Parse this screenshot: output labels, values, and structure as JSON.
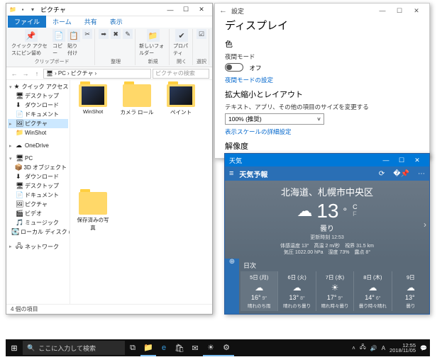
{
  "explorer": {
    "title": "ピクチャ",
    "tabs": {
      "file": "ファイル",
      "home": "ホーム",
      "share": "共有",
      "view": "表示"
    },
    "ribbon": {
      "g1": {
        "pin": "クイック アクセスにピン留め",
        "copy": "コピー",
        "paste": "貼り付け",
        "name": "クリップボード"
      },
      "g2": {
        "name": "整理"
      },
      "g3": {
        "newf": "新しいフォルダー",
        "name": "新規"
      },
      "g4": {
        "prop": "プロパティ",
        "name": "開く"
      },
      "g5": {
        "name": "選択"
      }
    },
    "breadcrumb": {
      "pc": "PC",
      "pic": "ピクチャ"
    },
    "search_placeholder": "ピクチャの検索",
    "folders": [
      {
        "label": "WinShot",
        "thumb": true
      },
      {
        "label": "カメラ ロール",
        "thumb": false
      },
      {
        "label": "ペイント",
        "thumb": true
      },
      {
        "label": "保存済みの写真",
        "thumb": false
      }
    ],
    "nav": {
      "quick": "クイック アクセス",
      "desktop": "デスクトップ",
      "downloads": "ダウンロード",
      "documents": "ドキュメント",
      "pictures": "ピクチャ",
      "winshot": "WinShot",
      "onedrive": "OneDrive",
      "pc": "PC",
      "obj3d": "3D オブジェクト",
      "dl2": "ダウンロード",
      "desk2": "デスクトップ",
      "doc2": "ドキュメント",
      "pic2": "ピクチャ",
      "video": "ビデオ",
      "music": "ミュージック",
      "cdrive": "ローカル ディスク (C:)",
      "network": "ネットワーク"
    },
    "status": "4 個の項目"
  },
  "settings": {
    "win_title": "設定",
    "h1": "ディスプレイ",
    "color_h": "色",
    "night_label": "夜間モード",
    "toggle_off": "オフ",
    "night_link": "夜間モードの設定",
    "scale_h": "拡大縮小とレイアウト",
    "scale_label": "テキスト、アプリ、その他の項目のサイズを変更する",
    "scale_value": "100% (推奨)",
    "scale_link": "表示スケールの詳細設定",
    "res_h": "解像度"
  },
  "weather": {
    "app": "天気",
    "header": "天気予報",
    "location": "北海道、札幌市中央区",
    "temp": "13",
    "unit_c": "C",
    "unit_f": "F",
    "cond": "曇り",
    "updated": "更新時刻 12:53",
    "details1": "体感温度 13°　高温 2 m/秒　視界 31.5 km",
    "details2": "気圧 1022.00 hPa　湿度 73%　露点 8°",
    "daily_h": "日次",
    "days": [
      {
        "d": "5日 (月)",
        "i": "☁",
        "hi": "16°",
        "lo": "9°",
        "c": "晴れのち雨"
      },
      {
        "d": "6日 (火)",
        "i": "☁",
        "hi": "13°",
        "lo": "8°",
        "c": "晴れのち曇り"
      },
      {
        "d": "7日 (水)",
        "i": "☀",
        "hi": "17°",
        "lo": "9°",
        "c": "晴れ時々曇り"
      },
      {
        "d": "8日 (木)",
        "i": "☁",
        "hi": "14°",
        "lo": "6°",
        "c": "曇り時々晴れ"
      },
      {
        "d": "9日",
        "i": "☁",
        "hi": "13°",
        "lo": "",
        "c": "曇り"
      }
    ]
  },
  "taskbar": {
    "search": "ここに入力して検索",
    "time": "12:55",
    "date": "2018/11/05"
  }
}
